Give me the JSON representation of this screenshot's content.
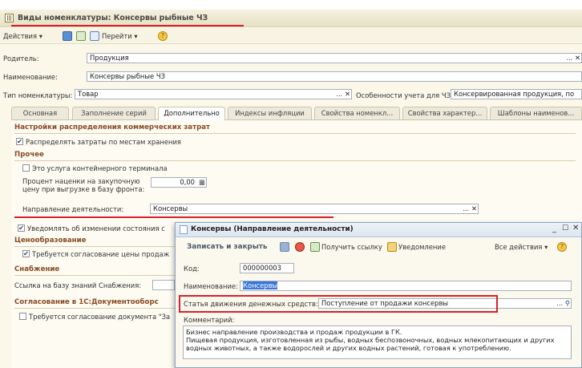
{
  "window": {
    "title": "Виды номенклатуры: Консервы рыбные ЧЗ"
  },
  "toolbar": {
    "actions_label": "Действия ▾",
    "goto_label": "Перейти ▾",
    "help_label": "?"
  },
  "fields": {
    "parent_label": "Родитель:",
    "parent_value": "Продукция",
    "name_label": "Наименование:",
    "name_value": "Консервы рыбные ЧЗ",
    "type_label": "Тип номенклатуры:",
    "type_value": "Товар",
    "cz_label": "Особенности учета для ЧЗ:",
    "cz_value": "Консервированная продукция, по"
  },
  "tabs": [
    "Основная",
    "Заполнение серий",
    "Дополнительно",
    "Индексы инфляции",
    "Свойства номенкл...",
    "Свойства характер...",
    "Шаблоны наименов..."
  ],
  "active_tab": 2,
  "panel": {
    "sec1": "Настройки распределения коммерческих затрат",
    "cb1": "Распределять затраты по местам хранения",
    "sec2": "Прочее",
    "cb2": "Это услуга контейнерного терминала",
    "markup_label_1": "Процент наценки на закупочную",
    "markup_label_2": "цену при выгрузке в базу фронта:",
    "markup_value": "0,00",
    "direction_label": "Направление деятельности:",
    "direction_value": "Консервы",
    "cb3": "Уведомлять об изменении состояния с",
    "sec3": "Ценообразование",
    "cb4": "Требуется согласование цены продаж",
    "sec4": "Снабжение",
    "kb_label": "Ссылка на базу знаний Снабжения:",
    "sec5": "Согласование в 1С:Документооборс",
    "cb5": "Требуется согласование документа \"За"
  },
  "dialog": {
    "title": "Консервы (Направление деятельности)",
    "save_close": "Записать и закрыть",
    "get_link": "Получить ссылку",
    "notify": "Уведомление",
    "all_actions": "Все действия ▾",
    "help": "?",
    "code_label": "Код:",
    "code_value": "000000003",
    "name_label": "Наименование:",
    "name_value": "Консервы",
    "cash_label": "Статья движения денежных средств:",
    "cash_value": "Поступление от продажи консервы",
    "comment_label": "Комментарий:",
    "comment_text": "Бизнес направление производства и продаж продукции в ГК.\nПищевая продукция, изготовленная из рыбы, водных беспозвоночных, водных млекопитающих и других водных животных, а также водорослей и других водных растений, готовая к употреблению."
  },
  "colors": {
    "accent_red": "#d8202a",
    "section": "#8a4b24",
    "selection": "#3875d7"
  }
}
